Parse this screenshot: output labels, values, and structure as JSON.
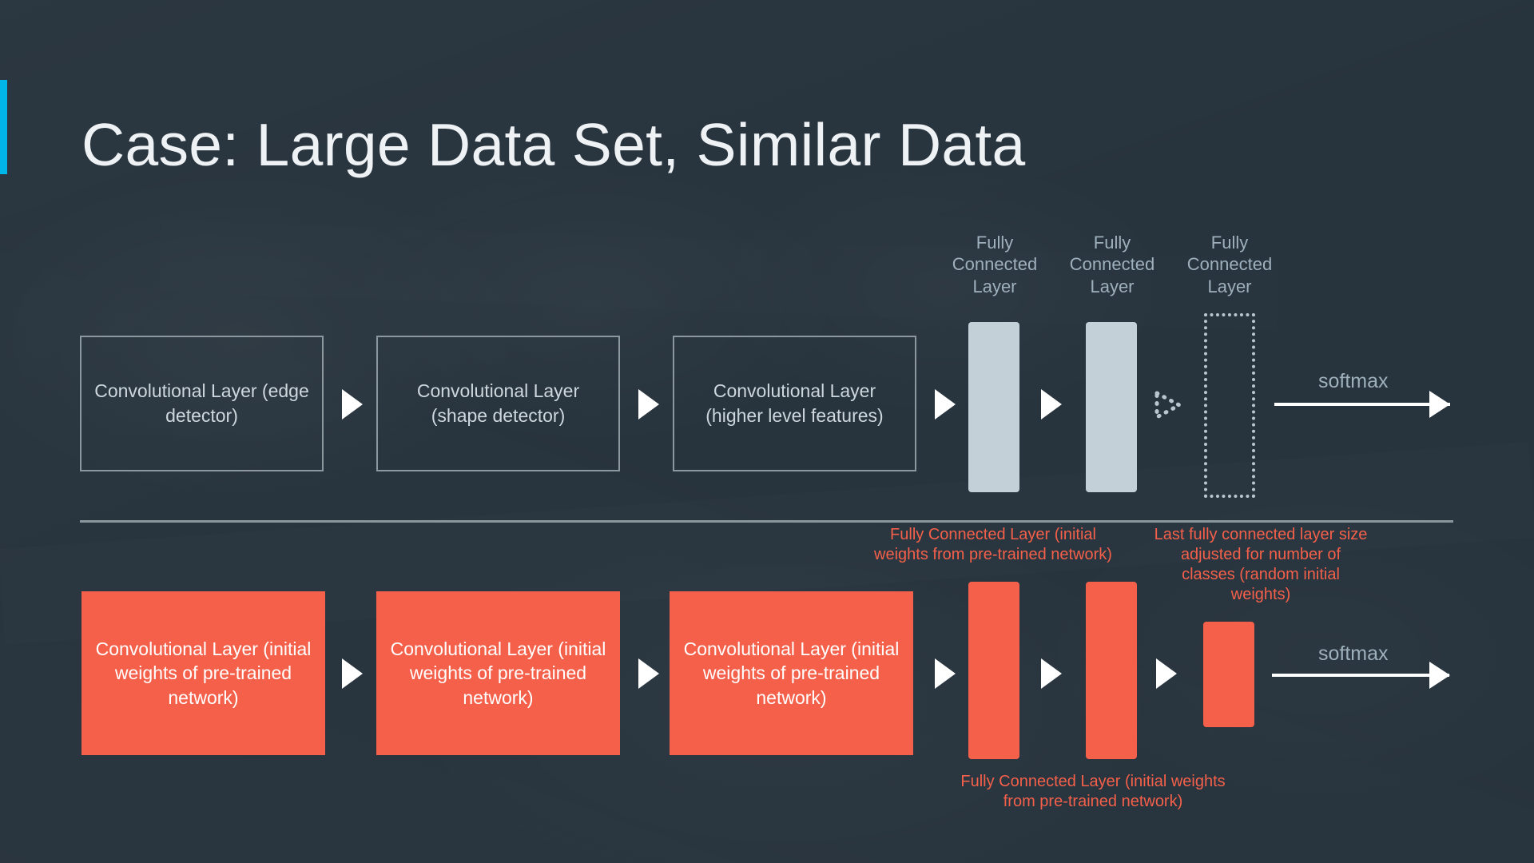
{
  "slide": {
    "title": "Case: Large Data Set, Similar Data",
    "accent_color": "#00b6e8",
    "background_color": "#27333d",
    "highlight_color": "#f4604a"
  },
  "top_row": {
    "conv_layers": [
      {
        "label": "Convolutional Layer (edge detector)"
      },
      {
        "label": "Convolutional Layer (shape detector)"
      },
      {
        "label": "Convolutional Layer (higher level features)"
      }
    ],
    "fc_labels": [
      "Fully Connected Layer",
      "Fully Connected Layer",
      "Fully Connected Layer"
    ],
    "softmax_label": "softmax"
  },
  "bottom_row": {
    "conv_layers": [
      {
        "label": "Convolutional Layer (initial weights of pre-trained network)"
      },
      {
        "label": "Convolutional Layer (initial weights of pre-trained network)"
      },
      {
        "label": "Convolutional Layer (initial weights of pre-trained network)"
      }
    ],
    "softmax_label": "softmax"
  },
  "annotations": {
    "fc_pretrained_top": "Fully Connected Layer (initial weights from pre-trained network)",
    "last_fc_adjusted": "Last fully connected layer size adjusted for number of classes (random initial weights)",
    "fc_pretrained_bottom": "Fully Connected Layer (initial weights from pre-trained network)"
  }
}
